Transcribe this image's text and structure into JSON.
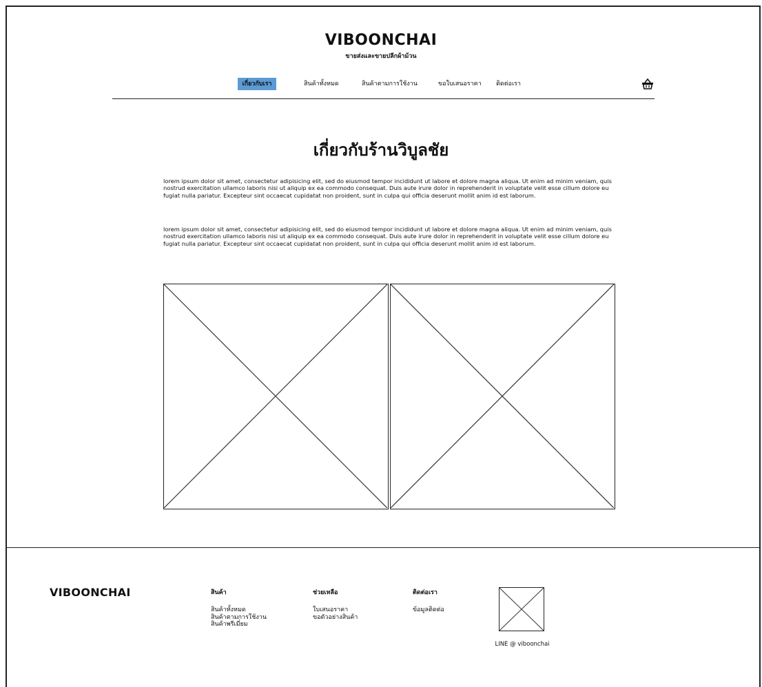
{
  "header": {
    "brand": "VIBOONCHAI",
    "tagline": "ขายส่งและขายปลีกผ้าม้วน",
    "nav": [
      {
        "label": "เกี่ยวกับเรา",
        "active": true
      },
      {
        "label": "สินค้าทั้งหมด",
        "active": false
      },
      {
        "label": "สินค้าตามการใช้งาน",
        "active": false
      },
      {
        "label": "ขอใบเสนอราคา",
        "active": false
      },
      {
        "label": "ติดต่อเรา",
        "active": false
      }
    ],
    "cart_icon": "basket-icon",
    "active_color": "#5b9bd5"
  },
  "main": {
    "title": "เกี่ยวกับร้านวิบูลชัย",
    "paragraphs": [
      "lorem ipsum dolor sit amet, consectetur adipisicing elit, sed do eiusmod tempor incididunt ut labore et dolore magna aliqua. Ut enim ad minim veniam, quis nostrud exercitation ullamco laboris nisi ut aliquip ex ea commodo consequat. Duis aute irure dolor in reprehenderit in voluptate velit esse cillum dolore eu fugiat nulla pariatur. Excepteur sint occaecat cupidatat non proident, sunt in culpa qui officia deserunt mollit anim id est laborum.",
      "lorem ipsum dolor sit amet, consectetur adipisicing elit, sed do eiusmod tempor incididunt ut labore et dolore magna aliqua. Ut enim ad minim veniam, quis nostrud exercitation ullamco laboris nisi ut aliquip ex ea commodo consequat. Duis aute irure dolor in reprehenderit in voluptate velit esse cillum dolore eu fugiat nulla pariatur. Excepteur sint occaecat cupidatat non proident, sunt in culpa qui officia deserunt mollit anim id est laborum."
    ]
  },
  "footer": {
    "brand": "VIBOONCHAI",
    "columns": [
      {
        "title": "สินค้า",
        "links": [
          "สินค้าทั้งหมด",
          "สินค้าตามการใช้งาน",
          "สินค้าพรีเมี่ยม"
        ]
      },
      {
        "title": "ช่วยเหลือ",
        "links": [
          "ใบเสนอราคา",
          "ขอตัวอย่างสินค้า"
        ]
      },
      {
        "title": "ติดต่อเรา",
        "links": [
          "ข้อมูลติดต่อ"
        ]
      }
    ],
    "line_caption": "LINE @ viboonchai"
  }
}
